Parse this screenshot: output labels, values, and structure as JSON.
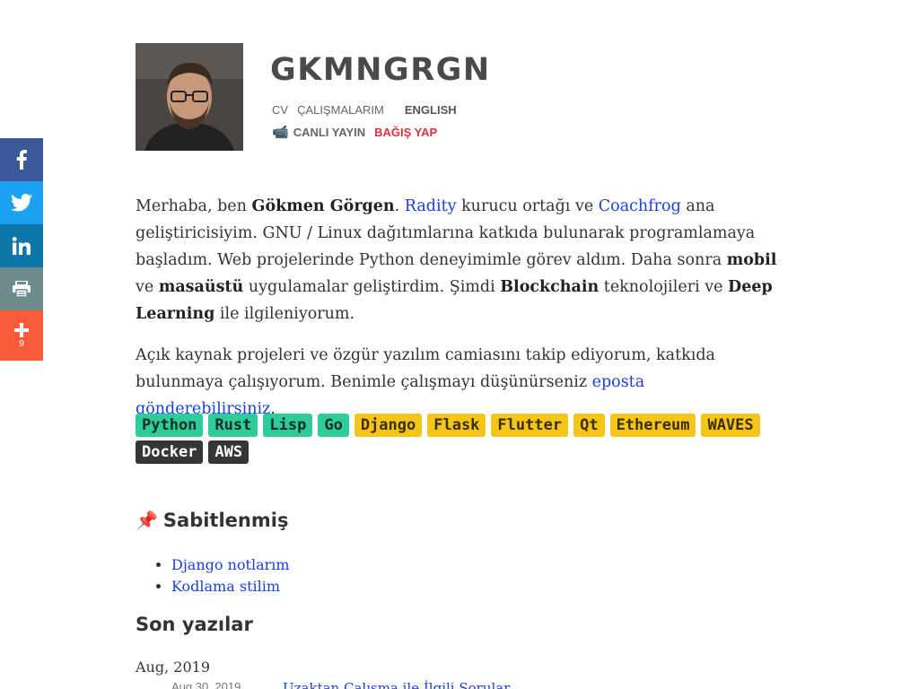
{
  "share": {
    "items": [
      {
        "name": "facebook",
        "icon": "facebook-icon"
      },
      {
        "name": "twitter",
        "icon": "twitter-icon"
      },
      {
        "name": "linkedin",
        "icon": "linkedin-icon"
      },
      {
        "name": "print",
        "icon": "print-icon"
      },
      {
        "name": "more",
        "icon": "plus-icon",
        "count": "9"
      }
    ],
    "colors": {
      "facebook": "#3b5998",
      "twitter": "#1da1f2",
      "linkedin": "#0e76a8",
      "print": "#6d8b8b",
      "more": "#f85c3a"
    }
  },
  "header": {
    "title": "GKMNGRGN",
    "nav": {
      "cv": "CV",
      "works": "ÇALIŞMALARIM",
      "english": "ENGLISH",
      "live_icon": "📹",
      "live": "CANLI YAYIN",
      "donate": "BAĞIŞ YAP"
    }
  },
  "bio": {
    "p1": {
      "t1": "Merhaba, ben ",
      "name": "Gökmen Görgen",
      "t2": ". ",
      "link1": "Radity",
      "t3": " kurucu ortağı ve ",
      "link2": "Coachfrog",
      "t4": " ana geliştiricisiyim. GNU / Linux dağıtımlarına katkıda bulunarak programlamaya başladım. Web projelerinde Python deneyimimle görev aldım. Daha sonra ",
      "b1": "mobil",
      "t5": " ve ",
      "b2": "masaüstü",
      "t6": " uygulamalar geliştirdim. Şimdi ",
      "b3": "Blockchain",
      "t7": " teknolojileri ve ",
      "b4": "Deep Learning",
      "t8": " ile ilgileniyorum."
    },
    "p2": {
      "t1": "Açık kaynak projeleri ve özgür yazılım camiasını takip ediyorum, katkıda bulunmaya çalışıyorum. Benimle çalışmayı düşünürseniz ",
      "link": "eposta gönderebilirsiniz",
      "t2": "."
    }
  },
  "tags": [
    {
      "label": "Python",
      "color": "green"
    },
    {
      "label": "Rust",
      "color": "green"
    },
    {
      "label": "Lisp",
      "color": "green"
    },
    {
      "label": "Go",
      "color": "green"
    },
    {
      "label": "Django",
      "color": "yellow"
    },
    {
      "label": "Flask",
      "color": "yellow"
    },
    {
      "label": "Flutter",
      "color": "yellow"
    },
    {
      "label": "Qt",
      "color": "yellow"
    },
    {
      "label": "Ethereum",
      "color": "yellow"
    },
    {
      "label": "WAVES",
      "color": "yellow"
    },
    {
      "label": "Docker",
      "color": "dark"
    },
    {
      "label": "AWS",
      "color": "dark"
    }
  ],
  "pinned": {
    "icon": "📌",
    "title": "Sabitlenmiş",
    "items": [
      "Django notlarım",
      "Kodlama stilim"
    ]
  },
  "recent": {
    "title": "Son yazılar",
    "month": "Aug, 2019",
    "posts": [
      {
        "date": "Aug 30, 2019",
        "title": "Uzaktan Çalışma ile İlgili Sorular"
      }
    ]
  }
}
